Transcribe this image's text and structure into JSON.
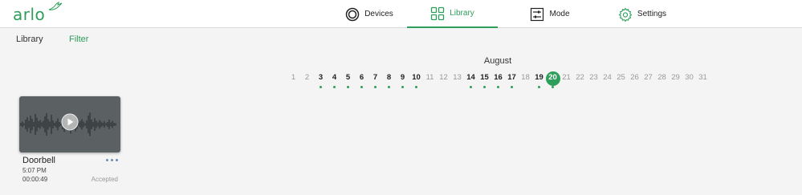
{
  "brand": {
    "logo_text": "arlo",
    "color": "#2e9e5b"
  },
  "nav": {
    "items": [
      {
        "label": "Devices",
        "icon": "devices-icon",
        "active": false
      },
      {
        "label": "Library",
        "icon": "library-grid-icon",
        "active": true
      },
      {
        "label": "Mode",
        "icon": "mode-sliders-icon",
        "active": false
      },
      {
        "label": "Settings",
        "icon": "gear-icon",
        "active": false
      }
    ]
  },
  "subnav": {
    "library_label": "Library",
    "filter_label": "Filter"
  },
  "calendar": {
    "month": "August",
    "selected_day": 20,
    "days_with_recordings": [
      3,
      4,
      5,
      6,
      7,
      8,
      9,
      10,
      14,
      15,
      16,
      17,
      19,
      20
    ],
    "days": [
      "1",
      "2",
      "3",
      "4",
      "5",
      "6",
      "7",
      "8",
      "9",
      "10",
      "11",
      "12",
      "13",
      "14",
      "15",
      "16",
      "17",
      "18",
      "19",
      "20",
      "21",
      "22",
      "23",
      "24",
      "25",
      "26",
      "27",
      "28",
      "29",
      "30",
      "31"
    ]
  },
  "recording": {
    "title": "Doorbell",
    "time": "5:07 PM",
    "duration": "00:00:49",
    "status": "Accepted",
    "thumbnail": "audio-waveform",
    "play_icon": "play-icon",
    "menu_icon": "more-options-icon"
  }
}
